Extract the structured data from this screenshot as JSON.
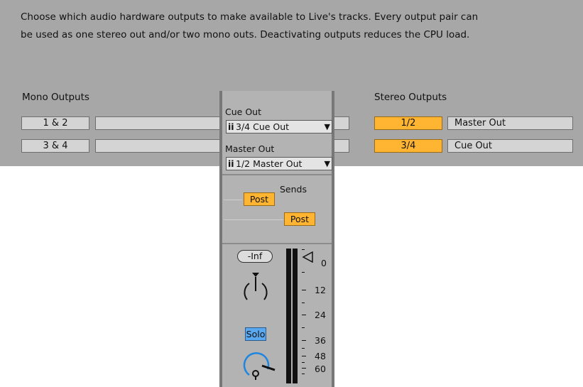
{
  "description": {
    "line1": "Choose which audio hardware outputs to make available to Live's tracks. Every output pair can",
    "line2": "be used as one stereo out and/or two mono outs.  Deactivating outputs reduces the CPU load."
  },
  "mono_outputs": {
    "label": "Mono Outputs",
    "rows": [
      {
        "pair": "1 & 2",
        "name": ""
      },
      {
        "pair": "3 & 4",
        "name": ""
      }
    ]
  },
  "stereo_outputs": {
    "label": "Stereo Outputs",
    "rows": [
      {
        "pair": "1/2",
        "name": "Master Out"
      },
      {
        "pair": "3/4",
        "name": "Cue Out"
      }
    ]
  },
  "mixer": {
    "cue_out": {
      "label": "Cue Out",
      "channel_icon": "ii",
      "value": "3/4 Cue Out",
      "arrow": "▼"
    },
    "master_out": {
      "label": "Master Out",
      "channel_icon": "ii",
      "value": "1/2 Master Out",
      "arrow": "▼"
    },
    "sends": {
      "label": "Sends",
      "send_a": "Post",
      "send_b": "Post"
    },
    "volume_display": "-Inf",
    "solo": "Solo",
    "meter_scale": [
      "0",
      "12",
      "24",
      "36",
      "48",
      "60"
    ]
  },
  "colors": {
    "panel_bg": "#a7a7a7",
    "active_orange": "#ffb532",
    "solo_blue": "#5aa8f0",
    "knob_blue": "#1f86e0"
  }
}
